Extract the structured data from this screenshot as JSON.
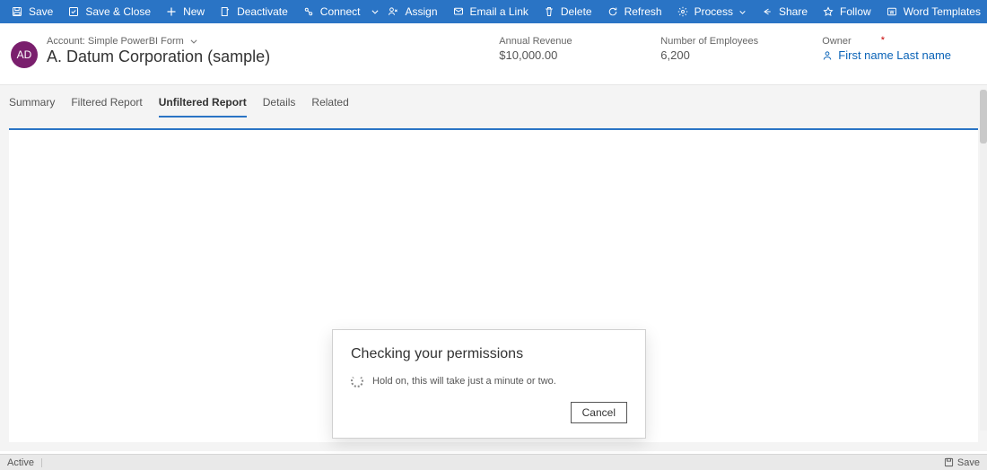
{
  "ribbon": {
    "save": "Save",
    "save_close": "Save & Close",
    "new": "New",
    "deactivate": "Deactivate",
    "connect": "Connect",
    "assign": "Assign",
    "email_link": "Email a Link",
    "delete": "Delete",
    "refresh": "Refresh",
    "process": "Process",
    "share": "Share",
    "follow": "Follow",
    "word_templates": "Word Templates"
  },
  "header": {
    "avatar_initials": "AD",
    "breadcrumb": "Account: Simple PowerBI Form",
    "title": "A. Datum Corporation (sample)",
    "fields": {
      "annual_revenue": {
        "label": "Annual Revenue",
        "value": "$10,000.00"
      },
      "num_employees": {
        "label": "Number of Employees",
        "value": "6,200"
      },
      "owner": {
        "label": "Owner",
        "value": "First name Last name"
      }
    }
  },
  "tabs": {
    "summary": "Summary",
    "filtered": "Filtered Report",
    "unfiltered": "Unfiltered Report",
    "details": "Details",
    "related": "Related",
    "active": "unfiltered"
  },
  "dialog": {
    "title": "Checking your permissions",
    "message": "Hold on, this will take just a minute or two.",
    "cancel": "Cancel"
  },
  "statusbar": {
    "state": "Active",
    "save": "Save"
  }
}
